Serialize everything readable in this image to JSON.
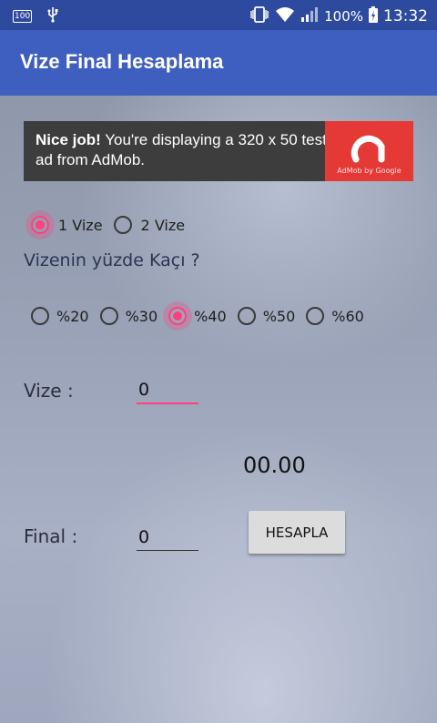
{
  "status_bar": {
    "left_icons": [
      "notification-100-icon",
      "usb-icon"
    ],
    "battery": "100%",
    "time": "13:32"
  },
  "app_bar": {
    "title": "Vize Final Hesaplama"
  },
  "ad": {
    "bold": "Nice job!",
    "text": " You're displaying a 320 x 50 test ad from AdMob.",
    "logo_caption": "AdMob by Google",
    "logo_color": "#e53935"
  },
  "vize_count": {
    "options": [
      "1 Vize",
      "2 Vize"
    ],
    "selected": "1 Vize"
  },
  "question": "Vizenin yüzde Kaçı ?",
  "percent": {
    "options": [
      "%20",
      "%30",
      "%40",
      "%50",
      "%60"
    ],
    "selected": "%40"
  },
  "vize": {
    "label": "Vize :",
    "value": "0"
  },
  "result": "00.00",
  "final": {
    "label": "Final :",
    "value": "0"
  },
  "button": {
    "label": "HESAPLA"
  },
  "colors": {
    "accent": "#ff4081",
    "primary": "#3f5fc0",
    "primary_dark": "#2e4a9e"
  }
}
